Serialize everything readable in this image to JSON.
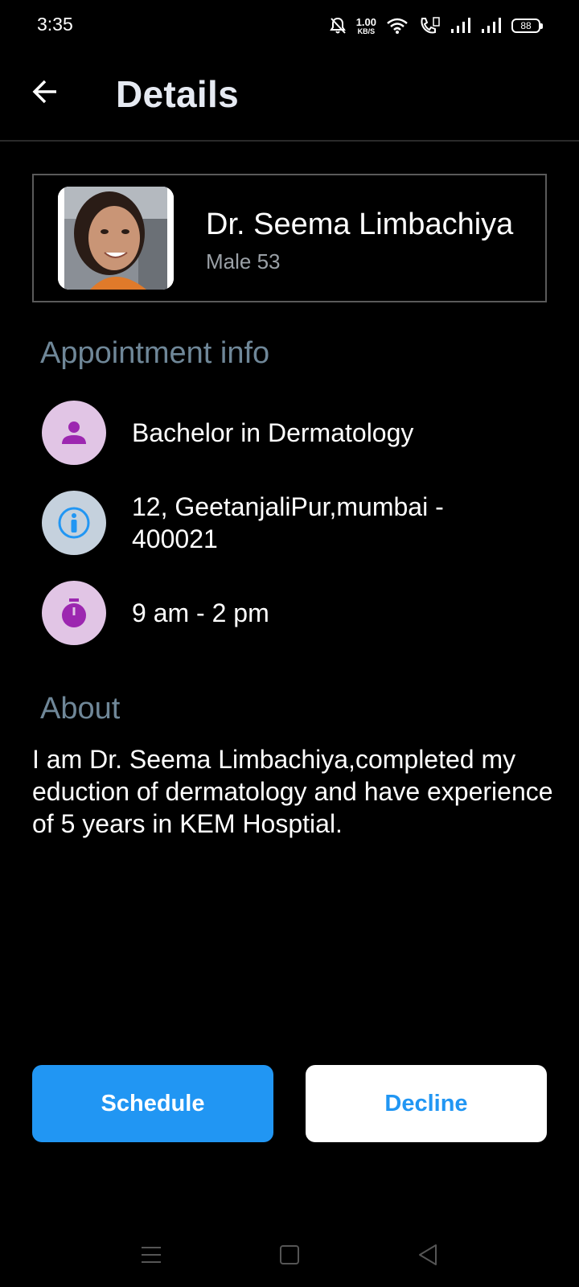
{
  "status_bar": {
    "time": "3:35",
    "net_speed_value": "1.00",
    "net_speed_unit": "KB/S",
    "battery": "88",
    "icons": [
      "mute-bell-icon",
      "wifi-icon",
      "volte-call-icon",
      "signal-icon",
      "signal-icon",
      "battery-icon"
    ]
  },
  "header": {
    "title": "Details",
    "back_icon": "arrow-left-icon"
  },
  "profile": {
    "name": "Dr. Seema Limbachiya",
    "meta": "Male 53",
    "avatar": "doctor-photo"
  },
  "appointment_info": {
    "heading": "Appointment info",
    "rows": [
      {
        "icon": "person-icon",
        "text": "Bachelor in Dermatology"
      },
      {
        "icon": "accessibility-info-icon",
        "text": "12, GeetanjaliPur,mumbai - 400021"
      },
      {
        "icon": "stopwatch-icon",
        "text": "9 am - 2 pm"
      }
    ]
  },
  "about": {
    "heading": "About",
    "text": "I am Dr. Seema Limbachiya,completed my eduction of dermatology and have experience of 5 years in KEM Hosptial."
  },
  "actions": {
    "schedule_label": "Schedule",
    "decline_label": "Decline"
  },
  "nav_bar": {
    "icons": [
      "menu-icon",
      "home-square-icon",
      "back-triangle-icon"
    ]
  },
  "colors": {
    "background": "#000000",
    "accent": "#2196f3",
    "heading": "#6f8798",
    "icon_purple": "#9c27b0",
    "icon_purple_bg": "#e1c5e5",
    "icon_blue": "#2196f3",
    "icon_blue_bg": "#c5d1dd"
  }
}
